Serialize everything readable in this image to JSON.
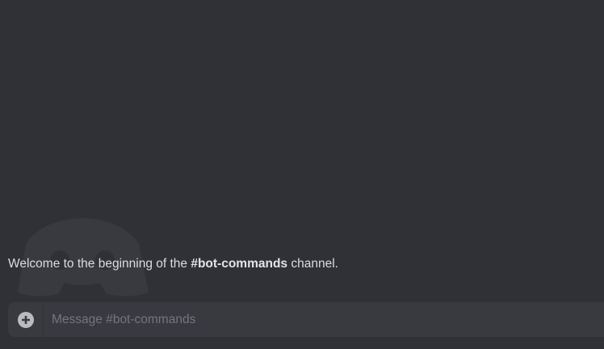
{
  "welcome": {
    "prefix": "Welcome to the beginning of the ",
    "channel": "#bot-commands",
    "suffix": " channel."
  },
  "composer": {
    "placeholder": "Message #bot-commands",
    "upload_icon": "plus-circle-icon"
  },
  "colors": {
    "background": "#303136",
    "input_background": "#383a40",
    "text": "#dcddde",
    "placeholder": "#72767d"
  }
}
